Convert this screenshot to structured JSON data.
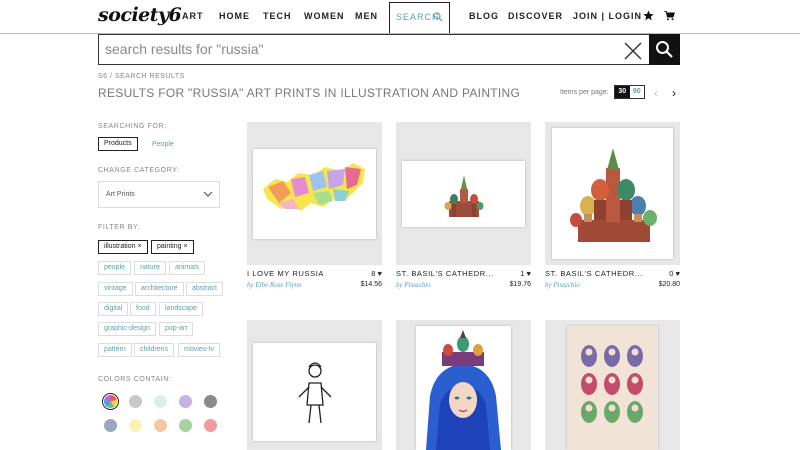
{
  "brand": {
    "logo_text": "society6"
  },
  "nav": {
    "items": [
      "ART",
      "HOME",
      "TECH",
      "WOMEN",
      "MEN"
    ],
    "search_label": "SEARCH",
    "right_items": [
      "BLOG",
      "DISCOVER"
    ],
    "account": "JOIN | LOGIN"
  },
  "search": {
    "placeholder": "search results for \"russia\""
  },
  "breadcrumb": "S6  /  SEARCH RESULTS",
  "title": "RESULTS FOR \"RUSSIA\" ART PRINTS IN ILLUSTRATION AND PAINTING",
  "pagination": {
    "items_per_page_label": "Items per page:",
    "options": [
      "30",
      "90"
    ],
    "selected": "30"
  },
  "sidebar": {
    "searching_for_label": "SEARCHING FOR:",
    "searching_for": {
      "selected": "Products",
      "other": "People"
    },
    "change_category_label": "CHANGE CATEGORY:",
    "category_value": "Art Prints",
    "filter_by_label": "FILTER BY:",
    "active_filters": [
      "illustration ×",
      "painting ×"
    ],
    "filters": [
      "people",
      "nature",
      "animals",
      "vintage",
      "architecture",
      "abstract",
      "digital",
      "food",
      "landscape",
      "graphic-design",
      "pop-art",
      "pattern",
      "childrens",
      "movies-tv"
    ],
    "colors_label": "COLORS CONTAIN:",
    "colors": [
      "multicolor",
      "#c8c8c8",
      "#d6f1ea",
      "#c5b2e0",
      "#8a8a8a",
      "#9aa6c2",
      "#f7f3b4",
      "#f3c8a1",
      "#a7d1a3",
      "#ef9a9f"
    ]
  },
  "products": [
    {
      "title": "I LOVE MY RUSSIA",
      "likes": "8",
      "author": "by Elbe Rose Flynn",
      "price": "$14.56"
    },
    {
      "title": "ST. BASIL'S CATHEDR...",
      "likes": "1",
      "author": "by Pistachio",
      "price": "$19.76"
    },
    {
      "title": "ST. BASIL'S CATHEDR...",
      "likes": "0",
      "author": "by Pistachio",
      "price": "$20.80"
    },
    {
      "title": "",
      "likes": "",
      "author": "",
      "price": ""
    },
    {
      "title": "",
      "likes": "",
      "author": "",
      "price": ""
    },
    {
      "title": "",
      "likes": "",
      "author": "",
      "price": ""
    }
  ]
}
